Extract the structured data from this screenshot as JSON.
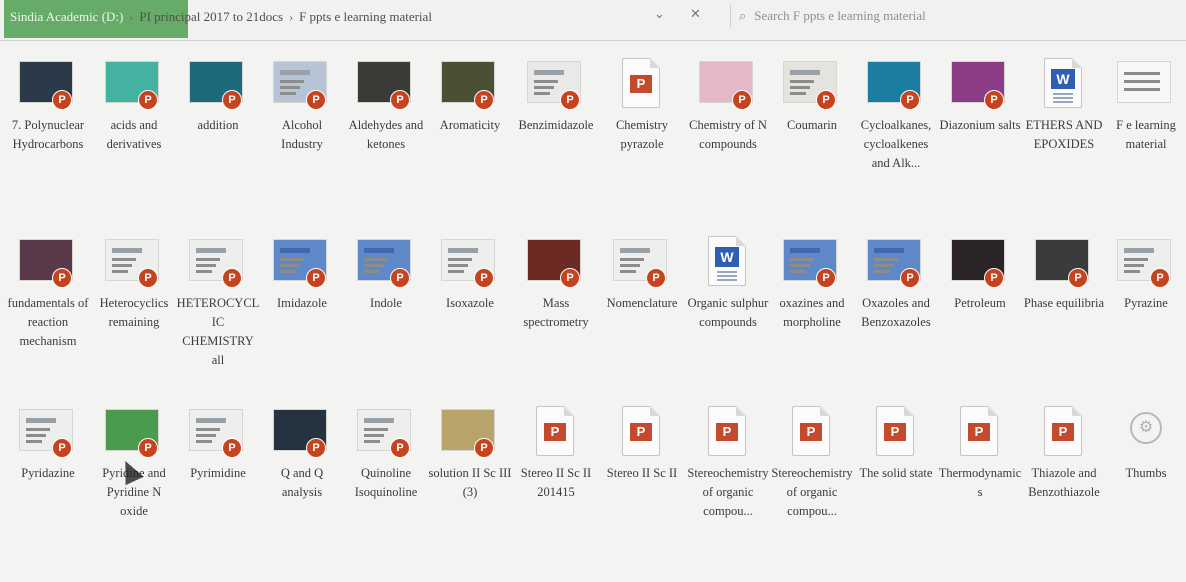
{
  "address": {
    "segments": [
      "Sindia Academic (D:)",
      "PI principal 2017 to 21docs",
      "F ppts e learning material"
    ],
    "separator": "›",
    "dropdown_glyph": "⌄",
    "close_glyph": "✕",
    "search_placeholder": "Search F ppts e learning material"
  },
  "files": [
    {
      "label": "7. Polynuclear Hydrocarbons",
      "type": "ppt",
      "thumb": "#2b3a48"
    },
    {
      "label": "acids and derivatives",
      "type": "ppt",
      "thumb": "#44b2a0"
    },
    {
      "label": "addition",
      "type": "ppt",
      "thumb": "#1d6b7a"
    },
    {
      "label": "Alcohol Industry",
      "type": "ppt",
      "thumb": "#b7c4d6"
    },
    {
      "label": "Aldehydes and ketones",
      "type": "ppt",
      "thumb": "#3a3a36"
    },
    {
      "label": "Aromaticity",
      "type": "ppt",
      "thumb": "#4b4f33"
    },
    {
      "label": "Benzimidazole",
      "type": "ppt",
      "thumb": "#e9e9e7"
    },
    {
      "label": "Chemistry pyrazole",
      "type": "pptdoc",
      "thumb": "#ffffff"
    },
    {
      "label": "Chemistry of N compounds",
      "type": "ppt",
      "thumb": "#e4b7c9"
    },
    {
      "label": "Coumarin",
      "type": "ppt",
      "thumb": "#e5e3de"
    },
    {
      "label": "Cycloalkanes, cycloalkenes and Alk...",
      "type": "ppt",
      "thumb": "#1c7da3"
    },
    {
      "label": "Diazonium salts",
      "type": "ppt",
      "thumb": "#8d3d87"
    },
    {
      "label": "ETHERS AND EPOXIDES",
      "type": "worddoc",
      "thumb": "#ffffff"
    },
    {
      "label": "F e learning material",
      "type": "folderish",
      "thumb": "#ececea"
    },
    {
      "label": "fundamentals of reaction mechanism",
      "type": "ppt",
      "thumb": "#5a3a4a"
    },
    {
      "label": "Heterocyclics remaining",
      "type": "ppt",
      "thumb": "#eeeeec"
    },
    {
      "label": "HETEROCYCLIC CHEMISTRY all",
      "type": "ppt",
      "thumb": "#eeeeec"
    },
    {
      "label": "Imidazole",
      "type": "ppt",
      "thumb": "#5f88c9"
    },
    {
      "label": "Indole",
      "type": "ppt",
      "thumb": "#5f88c9"
    },
    {
      "label": "Isoxazole",
      "type": "ppt",
      "thumb": "#eeeeec"
    },
    {
      "label": "Mass spectrometry",
      "type": "ppt",
      "thumb": "#6b2a24"
    },
    {
      "label": "Nomenclature",
      "type": "ppt",
      "thumb": "#eeeeec"
    },
    {
      "label": "Organic sulphur compounds",
      "type": "worddoc",
      "thumb": "#ffffff"
    },
    {
      "label": "oxazines and morpholine",
      "type": "ppt",
      "thumb": "#5f88c9"
    },
    {
      "label": "Oxazoles and Benzoxazoles",
      "type": "ppt",
      "thumb": "#5f88c9"
    },
    {
      "label": "Petroleum",
      "type": "ppt",
      "thumb": "#2a2327"
    },
    {
      "label": "Phase equilibria",
      "type": "ppt",
      "thumb": "#3b3b3b"
    },
    {
      "label": "Pyrazine",
      "type": "ppt",
      "thumb": "#eeeeec"
    },
    {
      "label": "Pyridazine",
      "type": "ppt",
      "thumb": "#eeeeec"
    },
    {
      "label": "Pyridine and Pyridine N oxide",
      "type": "ppt",
      "thumb": "#4b9a4e"
    },
    {
      "label": "Pyrimidine",
      "type": "ppt",
      "thumb": "#eeeeec"
    },
    {
      "label": "Q and Q analysis",
      "type": "ppt",
      "thumb": "#25323f"
    },
    {
      "label": "Quinoline Isoquinoline",
      "type": "ppt",
      "thumb": "#eeeeec"
    },
    {
      "label": "solution II Sc III (3)",
      "type": "ppt",
      "thumb": "#b8a46a"
    },
    {
      "label": "Stereo II Sc II 201415",
      "type": "pptdoc",
      "thumb": "#ffffff"
    },
    {
      "label": "Stereo II Sc II",
      "type": "pptdoc",
      "thumb": "#ffffff"
    },
    {
      "label": "Stereochemistry of organic compou...",
      "type": "pptdoc",
      "thumb": "#ffffff"
    },
    {
      "label": "Stereochemistry of organic compou...",
      "type": "pptdoc",
      "thumb": "#ffffff"
    },
    {
      "label": "The solid state",
      "type": "pptdoc",
      "thumb": "#ffffff"
    },
    {
      "label": "Thermodynamics",
      "type": "pptdoc",
      "thumb": "#ffffff"
    },
    {
      "label": "Thiazole and Benzothiazole",
      "type": "pptdoc",
      "thumb": "#ffffff"
    },
    {
      "label": "Thumbs",
      "type": "db",
      "thumb": "#ececea"
    }
  ]
}
